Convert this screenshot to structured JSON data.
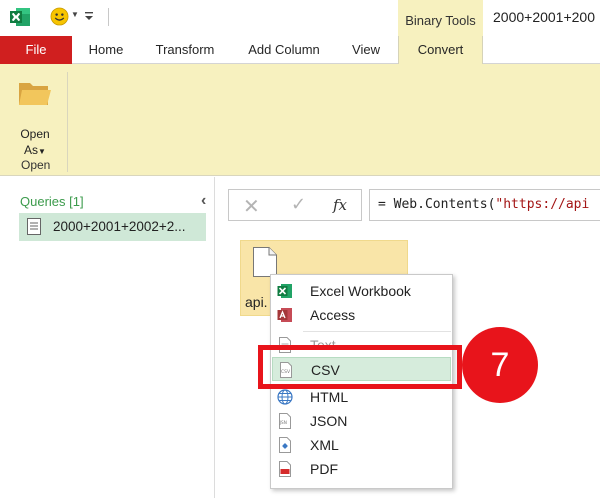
{
  "titlebar": {
    "context_group": "Binary Tools",
    "window_title": "2000+2001+200"
  },
  "tabs": [
    {
      "label": "File"
    },
    {
      "label": "Home"
    },
    {
      "label": "Transform"
    },
    {
      "label": "Add Column"
    },
    {
      "label": "View"
    },
    {
      "label": "Convert"
    }
  ],
  "ribbon": {
    "open_button_line1": "Open",
    "open_button_line2": "As",
    "group_label": "Open"
  },
  "queries": {
    "title": "Queries [1]",
    "items": [
      {
        "label": "2000+2001+2002+2..."
      }
    ]
  },
  "formula_bar": {
    "fx": "fx",
    "prefix": "= Web.Contents(",
    "string": "\"https://api"
  },
  "binary_tile": {
    "label": "api."
  },
  "context_menu": {
    "items": [
      {
        "label": "Excel Workbook",
        "icon": "excel-icon"
      },
      {
        "label": "Access",
        "icon": "access-icon"
      },
      {
        "label": "Text",
        "icon": "text-file-icon"
      },
      {
        "label": "CSV",
        "icon": "csv-icon"
      },
      {
        "label": "HTML",
        "icon": "globe-icon"
      },
      {
        "label": "JSON",
        "icon": "json-icon"
      },
      {
        "label": "XML",
        "icon": "xml-icon"
      },
      {
        "label": "PDF",
        "icon": "pdf-icon"
      }
    ]
  },
  "annotation": {
    "step_number": "7"
  },
  "colors": {
    "file_tab": "#d01f1f",
    "context_tab": "#f7f1bf",
    "selection_green": "#d6ecdc",
    "callout_red": "#e8141b",
    "queries_green": "#3c9b4c"
  }
}
